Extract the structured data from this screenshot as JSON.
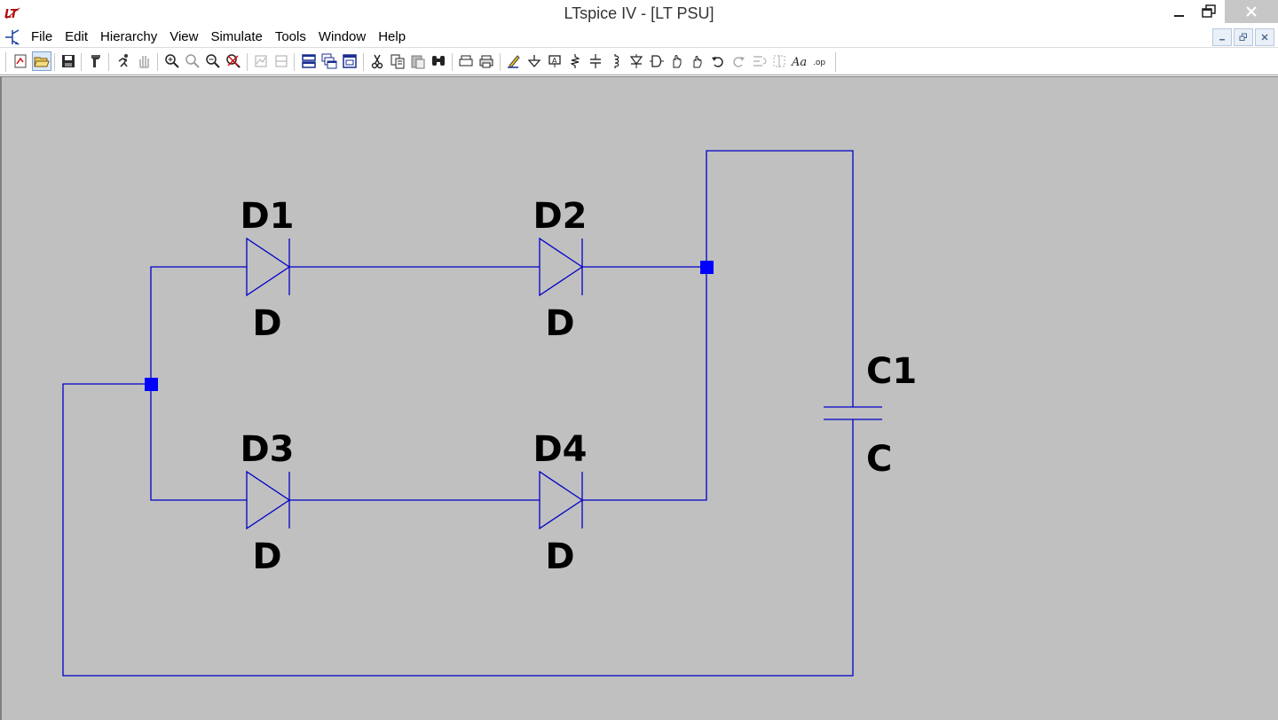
{
  "window": {
    "title": "LTspice IV - [LT PSU]",
    "app_icon": "ltspice-logo-icon",
    "controls": [
      "minimize-icon",
      "maximize-icon",
      "close-icon"
    ]
  },
  "menu": {
    "items": [
      {
        "label": "File"
      },
      {
        "label": "Edit"
      },
      {
        "label": "Hierarchy"
      },
      {
        "label": "View"
      },
      {
        "label": "Simulate"
      },
      {
        "label": "Tools"
      },
      {
        "label": "Window"
      },
      {
        "label": "Help"
      }
    ],
    "mdi_controls": [
      "mdi-minimize-icon",
      "mdi-restore-icon",
      "mdi-close-icon"
    ]
  },
  "toolbar": {
    "buttons": [
      "new-schematic-icon",
      "open-icon",
      "save-icon",
      "control-panel-icon",
      "run-icon",
      "halt-icon",
      "zoom-in-icon",
      "zoom-pan-icon",
      "zoom-out-icon",
      "zoom-fit-icon",
      "autorange-icon",
      "tile-vertical-icon",
      "tile-horizontal-icon",
      "cascade-icon",
      "close-window-icon",
      "cut-icon",
      "copy-icon",
      "paste-icon",
      "find-icon",
      "print-setup-icon",
      "print-icon",
      "draw-wire-icon",
      "ground-icon",
      "label-net-icon",
      "resistor-icon",
      "capacitor-icon",
      "inductor-icon",
      "diode-icon",
      "component-icon",
      "move-icon",
      "drag-icon",
      "undo-icon",
      "redo-icon",
      "rotate-icon",
      "mirror-icon",
      "text-icon",
      "spice-directive-icon"
    ]
  },
  "schematic": {
    "wire_color": "#0000c8",
    "junction_color": "#0000ff",
    "background": "#c0c0c0",
    "components": [
      {
        "ref": "D1",
        "value": "D",
        "kind": "diode"
      },
      {
        "ref": "D2",
        "value": "D",
        "kind": "diode"
      },
      {
        "ref": "D3",
        "value": "D",
        "kind": "diode"
      },
      {
        "ref": "D4",
        "value": "D",
        "kind": "diode"
      },
      {
        "ref": "C1",
        "value": "C",
        "kind": "capacitor"
      }
    ]
  }
}
